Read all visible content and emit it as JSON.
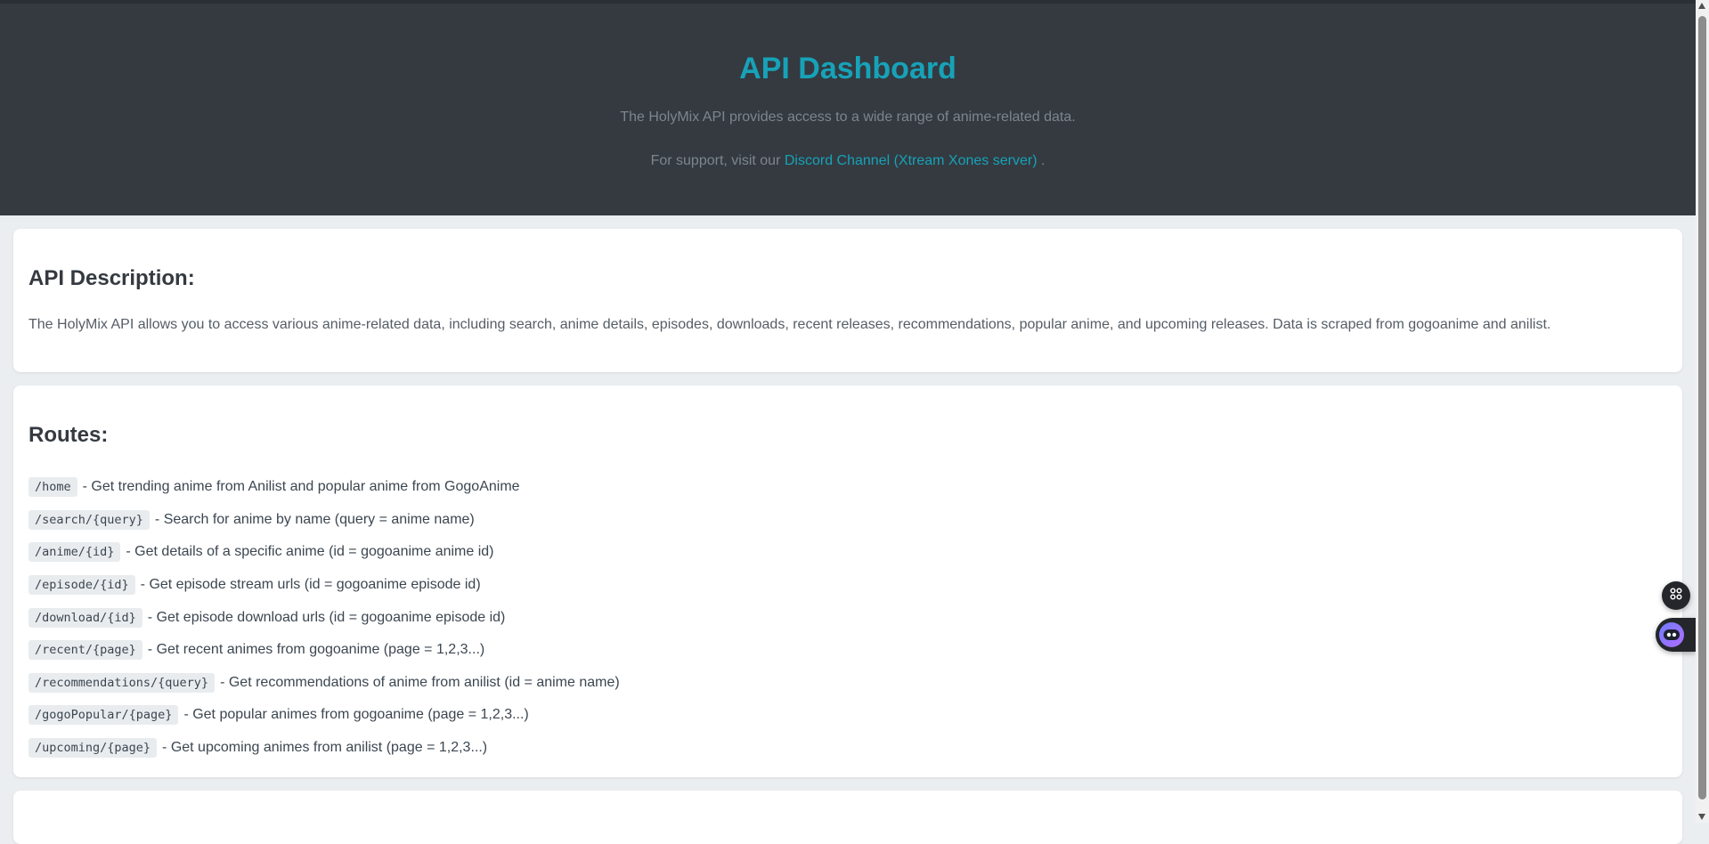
{
  "header": {
    "title": "API Dashboard",
    "subtitle": "The HolyMix API provides access to a wide range of anime-related data.",
    "support_prefix": "For support, visit our ",
    "support_link": "Discord Channel (Xtream Xones server)",
    "support_suffix": " ."
  },
  "description": {
    "heading": "API Description:",
    "text": "The HolyMix API allows you to access various anime-related data, including search, anime details, episodes, downloads, recent releases, recommendations, popular anime, and upcoming releases. Data is scraped from gogoanime and anilist."
  },
  "routes": {
    "heading": "Routes:",
    "items": [
      {
        "path": "/home",
        "desc": "- Get trending anime from Anilist and popular anime from GogoAnime"
      },
      {
        "path": "/search/{query}",
        "desc": "- Search for anime by name (query = anime name)"
      },
      {
        "path": "/anime/{id}",
        "desc": "- Get details of a specific anime (id = gogoanime anime id)"
      },
      {
        "path": "/episode/{id}",
        "desc": "- Get episode stream urls (id = gogoanime episode id)"
      },
      {
        "path": "/download/{id}",
        "desc": "- Get episode download urls (id = gogoanime episode id)"
      },
      {
        "path": "/recent/{page}",
        "desc": "- Get recent animes from gogoanime (page = 1,2,3...)"
      },
      {
        "path": "/recommendations/{query}",
        "desc": "- Get recommendations of anime from anilist (id = anime name)"
      },
      {
        "path": "/gogoPopular/{page}",
        "desc": "- Get popular animes from gogoanime (page = 1,2,3...)"
      },
      {
        "path": "/upcoming/{page}",
        "desc": "- Get upcoming animes from anilist (page = 1,2,3...)"
      }
    ]
  },
  "floating": {
    "grid_icon": "grid-icon",
    "bot_icon": "robot-icon"
  },
  "colors": {
    "header_bg": "#343a40",
    "accent": "#17a2b8",
    "page_bg": "#ebeef1",
    "code_bg": "#e9ecef"
  }
}
